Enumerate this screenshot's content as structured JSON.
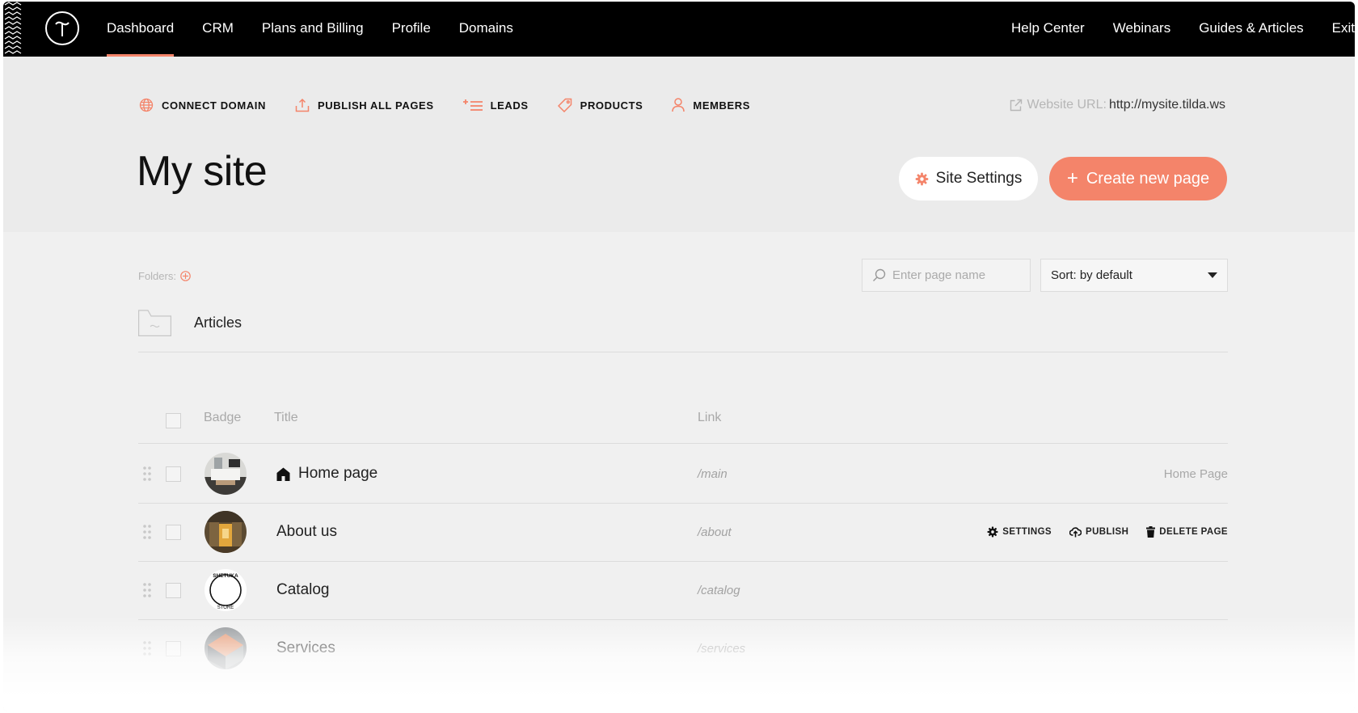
{
  "nav": {
    "left": [
      "Dashboard",
      "CRM",
      "Plans and Billing",
      "Profile",
      "Domains"
    ],
    "active": "Dashboard",
    "right": [
      "Help Center",
      "Webinars",
      "Guides & Articles",
      "Exit"
    ]
  },
  "actions": {
    "connect_domain": "CONNECT DOMAIN",
    "publish_all": "PUBLISH ALL PAGES",
    "leads": "LEADS",
    "products": "PRODUCTS",
    "members": "MEMBERS"
  },
  "website_url": {
    "label": "Website URL:",
    "value": "http://mysite.tilda.ws"
  },
  "page_title": "My site",
  "buttons": {
    "site_settings": "Site Settings",
    "create_new_page": "Create new page"
  },
  "folders": {
    "label": "Folders:",
    "items": [
      "Articles"
    ]
  },
  "search": {
    "placeholder": "Enter page name"
  },
  "sort": {
    "value": "Sort: by default"
  },
  "table": {
    "headers": {
      "badge": "Badge",
      "title": "Title",
      "link": "Link"
    },
    "rows": [
      {
        "title": "Home page",
        "link": "/main",
        "tag": "Home Page",
        "icon": "home-icon"
      },
      {
        "title": "About us",
        "link": "/about"
      },
      {
        "title": "Catalog",
        "link": "/catalog",
        "badge_text_top": "SHETUKA",
        "badge_text_bottom": "STORE"
      },
      {
        "title": "Services",
        "link": "/services"
      }
    ],
    "row_actions": {
      "settings": "SETTINGS",
      "publish": "PUBLISH",
      "delete": "DELETE PAGE"
    }
  },
  "colors": {
    "accent": "#f4846a",
    "topbar": "#000000",
    "header_bg": "#ebebeb",
    "content_bg": "#f0f0f0"
  }
}
